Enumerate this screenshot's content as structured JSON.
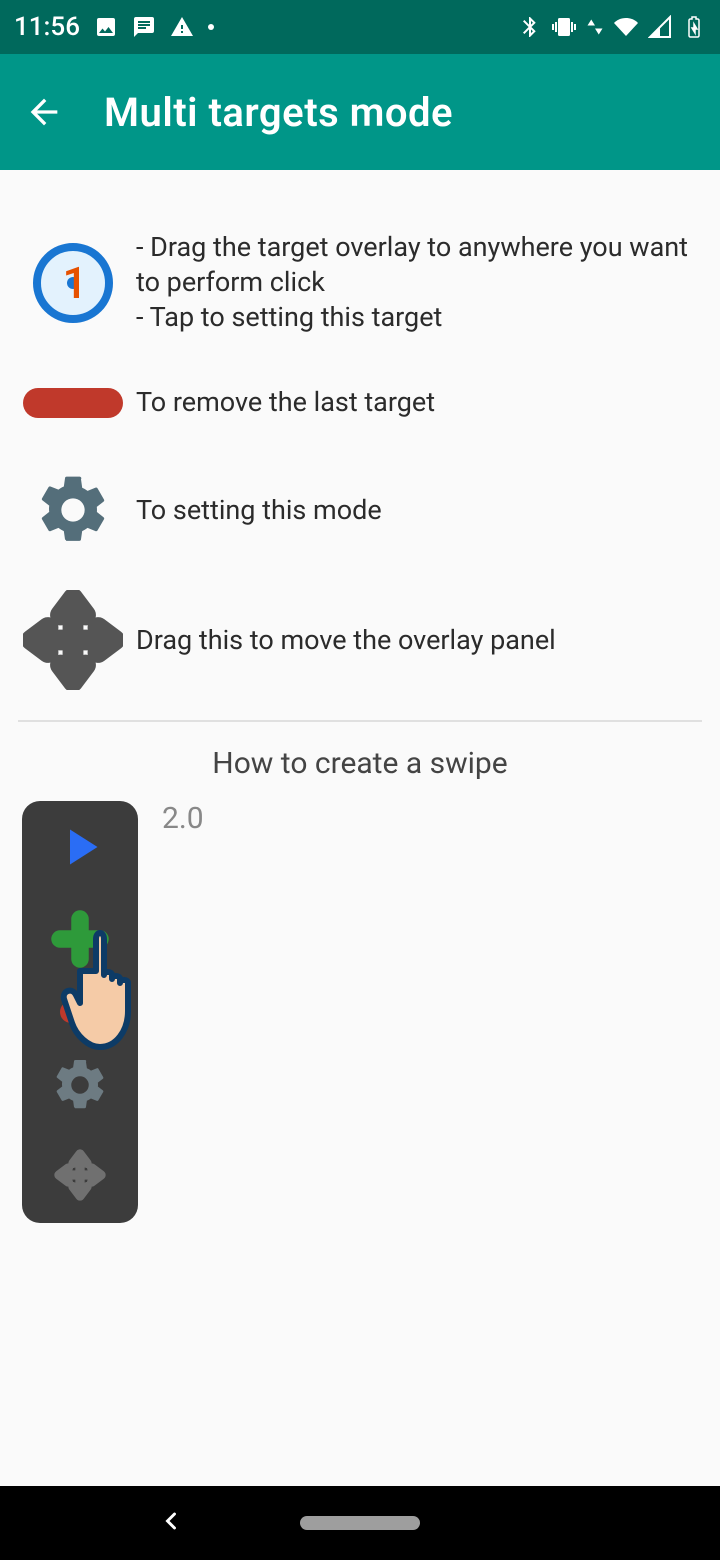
{
  "statusbar": {
    "time": "11:56"
  },
  "appbar": {
    "title": "Multi targets mode"
  },
  "instructions": {
    "target_number": "1",
    "target_text": "- Drag the target overlay to anywhere you want to perform click\n- Tap to setting this target",
    "remove_text": "To remove the last target",
    "settings_text": "To setting this mode",
    "move_text": "Drag this to move the overlay panel"
  },
  "swipe_section": {
    "title": "How to create a swipe",
    "version": "2.0"
  }
}
